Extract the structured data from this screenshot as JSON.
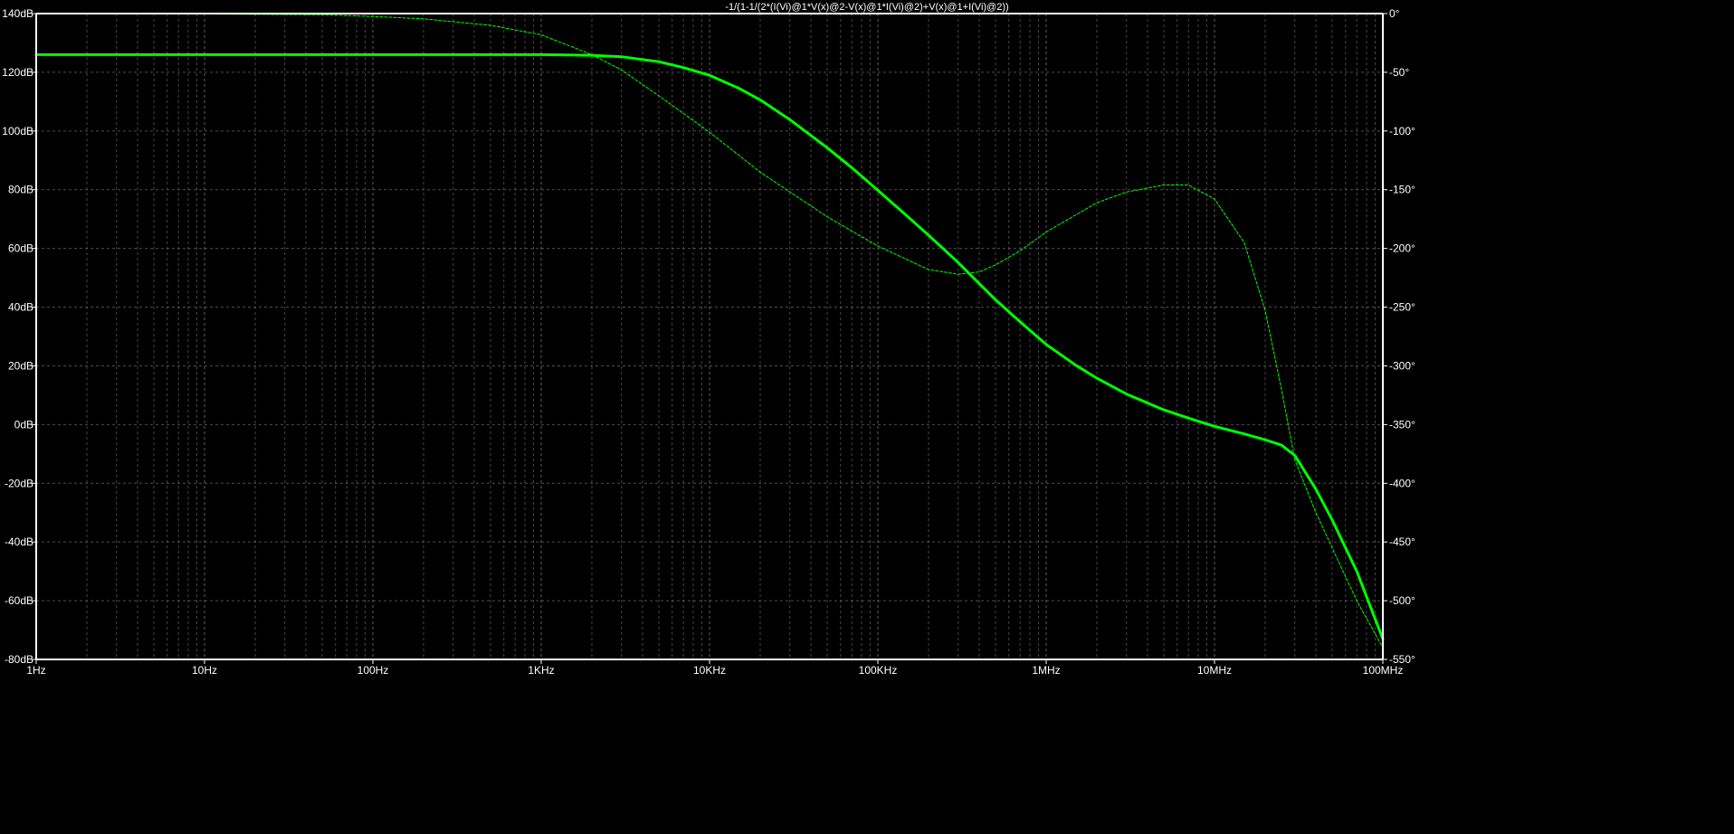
{
  "chart_data": {
    "type": "line",
    "title": "-1/(1-1/(2*(I(Vi)@1*V(x)@2-V(x)@1*I(Vi)@2)+V(x)@1+I(Vi)@2))",
    "x_scale": "log",
    "xlim": [
      1,
      100000000
    ],
    "x_ticks": [
      {
        "value": 1,
        "label": "1Hz"
      },
      {
        "value": 10,
        "label": "10Hz"
      },
      {
        "value": 100,
        "label": "100Hz"
      },
      {
        "value": 1000,
        "label": "1KHz"
      },
      {
        "value": 10000,
        "label": "10KHz"
      },
      {
        "value": 100000,
        "label": "100KHz"
      },
      {
        "value": 1000000,
        "label": "1MHz"
      },
      {
        "value": 10000000,
        "label": "10MHz"
      },
      {
        "value": 100000000,
        "label": "100MHz"
      }
    ],
    "y_left": {
      "range": [
        -80,
        140
      ],
      "ticks": [
        {
          "value": 140,
          "label": "140dB"
        },
        {
          "value": 120,
          "label": "120dB"
        },
        {
          "value": 100,
          "label": "100dB"
        },
        {
          "value": 80,
          "label": "80dB"
        },
        {
          "value": 60,
          "label": "60dB"
        },
        {
          "value": 40,
          "label": "40dB"
        },
        {
          "value": 20,
          "label": "20dB"
        },
        {
          "value": 0,
          "label": "0dB"
        },
        {
          "value": -20,
          "label": "-20dB"
        },
        {
          "value": -40,
          "label": "-40dB"
        },
        {
          "value": -60,
          "label": "-60dB"
        },
        {
          "value": -80,
          "label": "-80dB"
        }
      ]
    },
    "y_right": {
      "range": [
        -550,
        0
      ],
      "ticks": [
        {
          "value": 0,
          "label": "0°"
        },
        {
          "value": -50,
          "label": "-50°"
        },
        {
          "value": -100,
          "label": "-100°"
        },
        {
          "value": -150,
          "label": "-150°"
        },
        {
          "value": -200,
          "label": "-200°"
        },
        {
          "value": -250,
          "label": "-250°"
        },
        {
          "value": -300,
          "label": "-300°"
        },
        {
          "value": -350,
          "label": "-350°"
        },
        {
          "value": -400,
          "label": "-400°"
        },
        {
          "value": -450,
          "label": "-450°"
        },
        {
          "value": -500,
          "label": "-500°"
        },
        {
          "value": -550,
          "label": "-550°"
        }
      ]
    },
    "grid": true,
    "series": [
      {
        "axis": "left",
        "style": "solid",
        "color": "#00ff00",
        "points": [
          [
            1,
            126
          ],
          [
            10,
            126
          ],
          [
            100,
            126
          ],
          [
            1000,
            126
          ],
          [
            2000,
            125.8
          ],
          [
            3000,
            125.3
          ],
          [
            5000,
            123.6
          ],
          [
            7000,
            121.6
          ],
          [
            10000,
            119
          ],
          [
            15000,
            114.5
          ],
          [
            20000,
            110.6
          ],
          [
            30000,
            103.9
          ],
          [
            50000,
            94.3
          ],
          [
            70000,
            87.5
          ],
          [
            100000,
            79.8
          ],
          [
            150000,
            70.9
          ],
          [
            200000,
            64.5
          ],
          [
            300000,
            55.2
          ],
          [
            500000,
            42.5
          ],
          [
            700000,
            35
          ],
          [
            1000000,
            27.3
          ],
          [
            1500000,
            20.2
          ],
          [
            2000000,
            15.8
          ],
          [
            3000000,
            10.4
          ],
          [
            5000000,
            5
          ],
          [
            7000000,
            2.2
          ],
          [
            10000000,
            -0.6
          ],
          [
            15000000,
            -3.2
          ],
          [
            20000000,
            -5.2
          ],
          [
            25000000,
            -7
          ],
          [
            30000000,
            -10.5
          ],
          [
            40000000,
            -22
          ],
          [
            50000000,
            -32.5
          ],
          [
            70000000,
            -50
          ],
          [
            100000000,
            -73
          ]
        ]
      },
      {
        "axis": "right",
        "style": "dashed",
        "color": "#00ff00",
        "points": [
          [
            1,
            -0.1
          ],
          [
            10,
            -0.4
          ],
          [
            50,
            -1
          ],
          [
            100,
            -2.5
          ],
          [
            200,
            -4.5
          ],
          [
            500,
            -10
          ],
          [
            1000,
            -18
          ],
          [
            2000,
            -35
          ],
          [
            3000,
            -48
          ],
          [
            5000,
            -70
          ],
          [
            10000,
            -101
          ],
          [
            20000,
            -135
          ],
          [
            50000,
            -173
          ],
          [
            100000,
            -198
          ],
          [
            200000,
            -218
          ],
          [
            300000,
            -222
          ],
          [
            400000,
            -220
          ],
          [
            500000,
            -214
          ],
          [
            700000,
            -202
          ],
          [
            1000000,
            -186
          ],
          [
            2000000,
            -161
          ],
          [
            3000000,
            -152
          ],
          [
            5000000,
            -146
          ],
          [
            7000000,
            -146
          ],
          [
            10000000,
            -158
          ],
          [
            15000000,
            -195
          ],
          [
            20000000,
            -253
          ],
          [
            25000000,
            -320
          ],
          [
            30000000,
            -380
          ],
          [
            40000000,
            -425
          ],
          [
            50000000,
            -455
          ],
          [
            70000000,
            -500
          ],
          [
            100000000,
            -540
          ]
        ]
      }
    ]
  }
}
